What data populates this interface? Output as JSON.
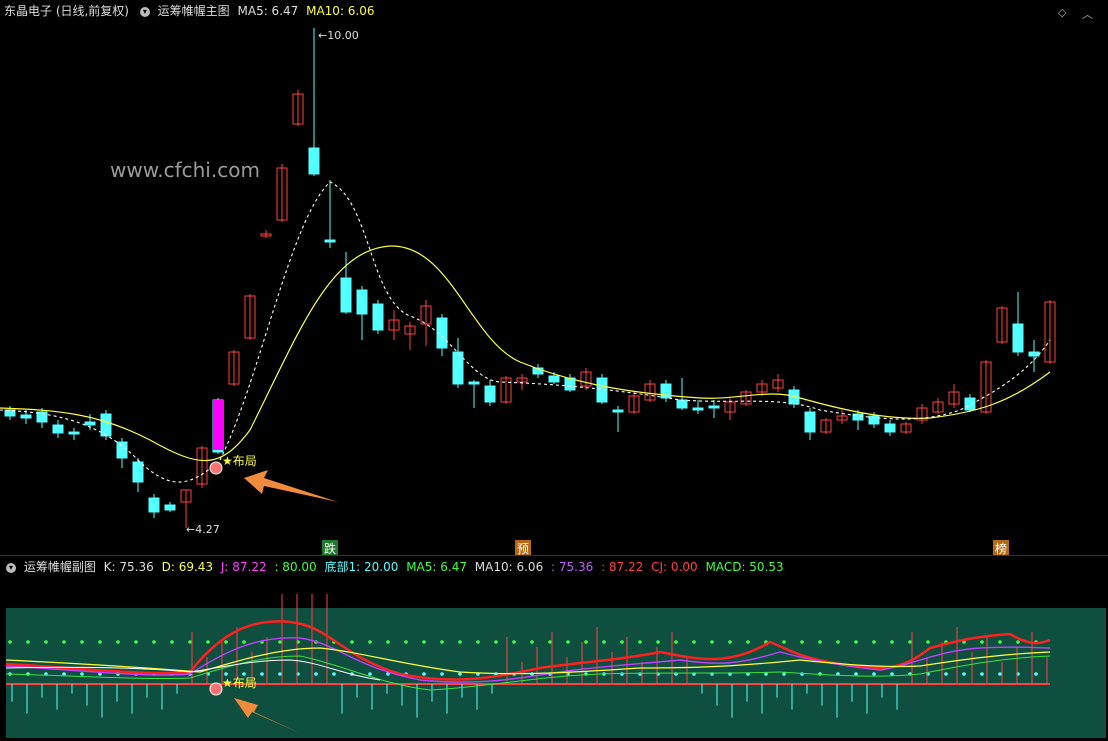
{
  "main_header": {
    "stock_name": "东晶电子 (日线,前复权)",
    "indicator_name": "运筹帷幄主图",
    "ma5_label": "MA5: 6.47",
    "ma10_label": "MA10: 6.06"
  },
  "main_chart": {
    "watermark": "www.cfchi.com",
    "high_label": "10.00",
    "low_label": "4.27",
    "signal_label": "布局",
    "markers": [
      {
        "text": "跌",
        "color": "#1f7a2e"
      },
      {
        "text": "预",
        "color": "#b36b16"
      },
      {
        "text": "榜",
        "color": "#b36b16"
      }
    ]
  },
  "sub_header": {
    "indicator_name": "运筹帷幄副图",
    "k": "K: 75.36",
    "d": "D: 69.43",
    "j": "J: 87.22",
    "v80": ": 80.00",
    "bottom": "底部1: 20.00",
    "ma5": "MA5: 6.47",
    "ma10": "MA10: 6.06",
    "v1": ": 75.36",
    "v2": ": 87.22",
    "cj": "CJ: 0.00",
    "macd": "MACD: 50.53"
  },
  "sub_chart": {
    "signal_label": "布局"
  },
  "colors": {
    "up": "#ff4040",
    "down": "#54ffff",
    "ma_yellow": "#ffff40",
    "ma_white": "#ffffff",
    "signal_bar": "#ff00ff",
    "arrow": "#f08a3c",
    "sub_bg": "#0e4f3f"
  },
  "icons": {
    "collapse": "chevron-down-icon",
    "settings": "diamond-icon",
    "close": "chevron-up-icon"
  }
}
